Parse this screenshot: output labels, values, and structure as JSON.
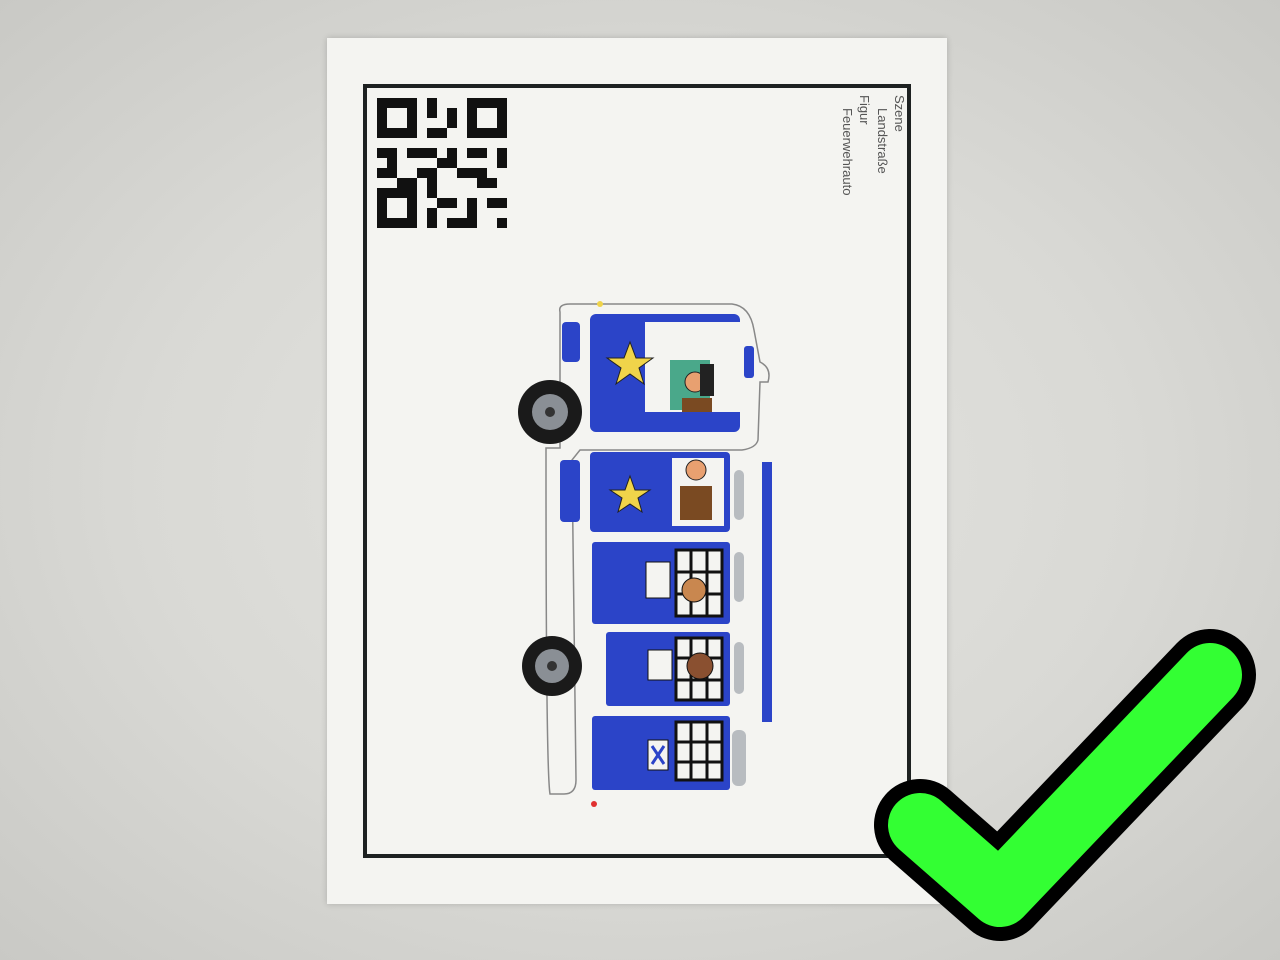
{
  "paper": {
    "labels": [
      "Szene",
      "Landstraße",
      "Figur",
      "Feuerwehrauto"
    ]
  },
  "icons": {
    "qr": "qr-code-icon",
    "check": "green-checkmark-icon"
  },
  "colors": {
    "vehicle_blue": "#2b44c8",
    "star_yellow": "#f0d44a",
    "check_green": "#33ff33",
    "frame_black": "#1d2121"
  }
}
